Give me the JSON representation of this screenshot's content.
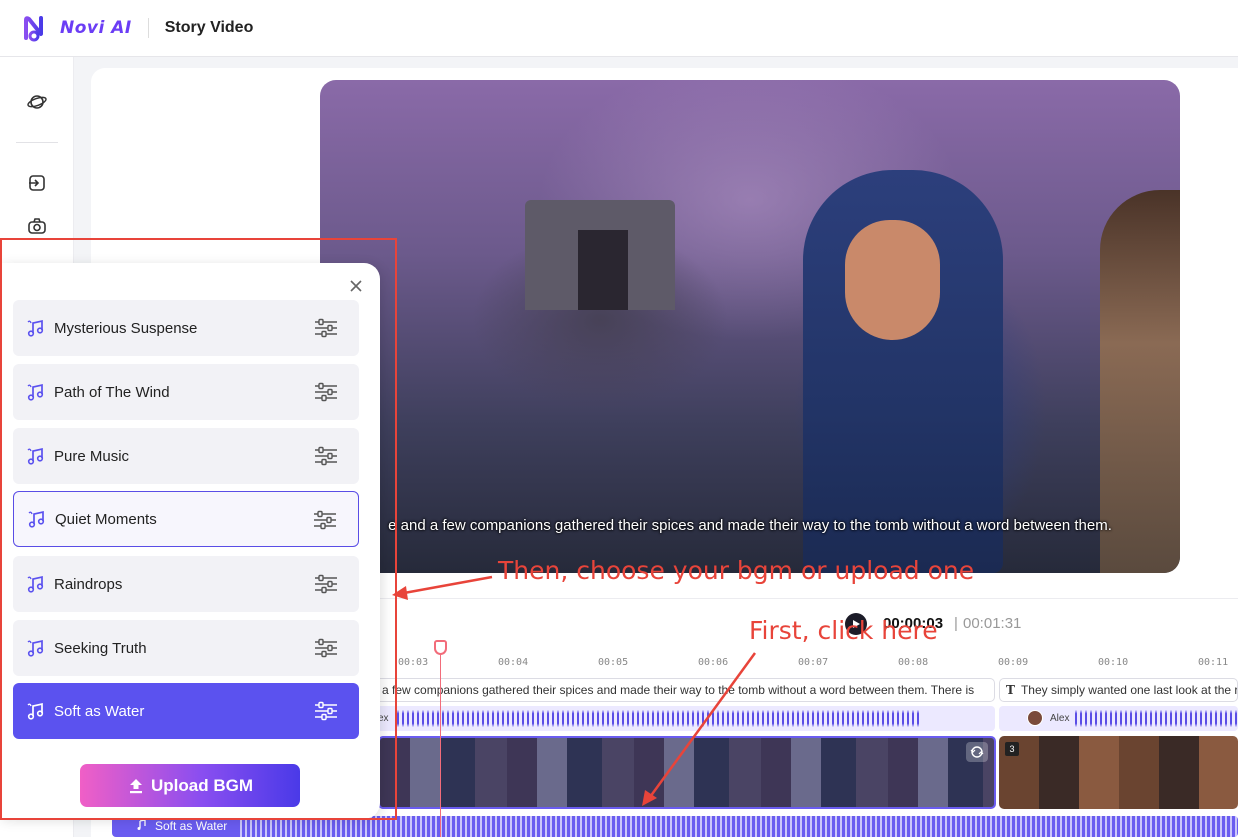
{
  "app": {
    "brand": "Novi AI",
    "page_title": "Story Video"
  },
  "rail": {
    "icons": [
      "planet-icon",
      "import-icon",
      "camera-icon"
    ]
  },
  "video": {
    "subtitle": "e and a few companions gathered their spices and made their way to the tomb without a word between them."
  },
  "player": {
    "current_time": "00:00:03",
    "separator": "|",
    "total_time": "00:01:31"
  },
  "timeline": {
    "ticks": [
      "00:03",
      "00:04",
      "00:05",
      "00:06",
      "00:07",
      "00:08",
      "00:09",
      "00:10",
      "00:11"
    ],
    "subtitle_clip_1": "d a few companions gathered their spices and made their way to the tomb without a word between them. There is",
    "subtitle_clip_2": "They simply wanted one last look at the r",
    "subtitle_type_icon": "T",
    "voice_1": "ex",
    "voice_2": "Alex",
    "clip_number": "3",
    "bgm_track_label": "Soft as Water"
  },
  "bgm_panel": {
    "items": [
      {
        "label": "Mysterious Suspense",
        "state": "normal"
      },
      {
        "label": "Path of The Wind",
        "state": "normal"
      },
      {
        "label": "Pure Music",
        "state": "normal"
      },
      {
        "label": "Quiet Moments",
        "state": "selected"
      },
      {
        "label": "Raindrops",
        "state": "normal"
      },
      {
        "label": "Seeking Truth",
        "state": "normal"
      },
      {
        "label": "Soft as Water",
        "state": "active"
      }
    ],
    "upload_label": "Upload BGM"
  },
  "annotations": {
    "step1": "First, click here",
    "step2": "Then, choose your bgm or upload one",
    "color": "#e8443a"
  },
  "colors": {
    "brand": "#6b3df5",
    "accent": "#5b52ef",
    "playhead": "#f26c7a"
  }
}
